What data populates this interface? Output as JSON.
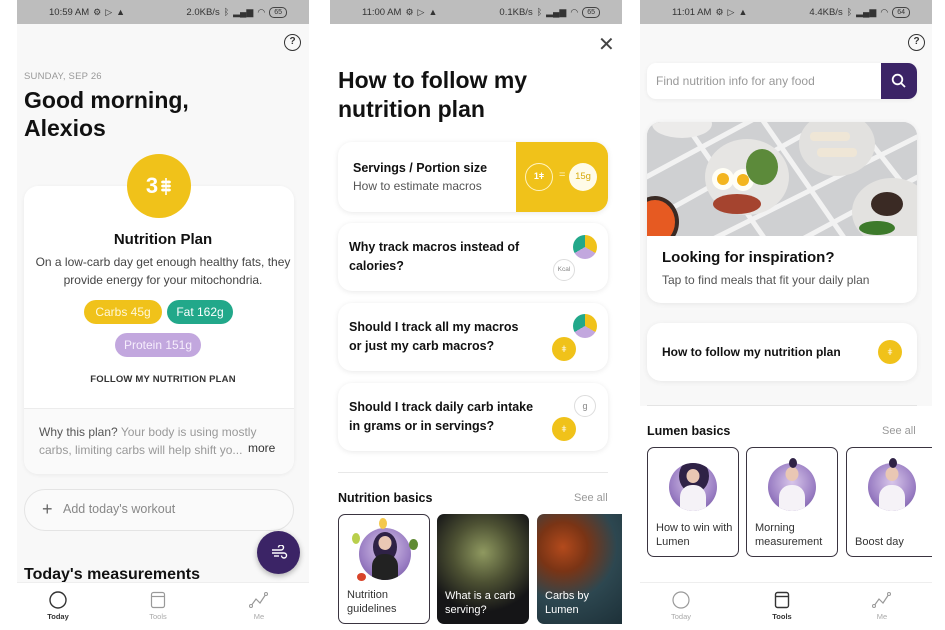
{
  "screens": [
    {
      "status": {
        "time": "10:59 AM",
        "speed": "2.0KB/s",
        "battery": "65"
      },
      "date": "SUNDAY, SEP 26",
      "greeting": "Good morning, Alexios",
      "plan": {
        "badge_number": "3",
        "title": "Nutrition Plan",
        "description": "On a low-carb day get enough healthy fats, they provide energy for your mitochondria.",
        "macros": {
          "carbs": "Carbs 45g",
          "fat": "Fat 162g",
          "protein": "Protein 151g"
        },
        "follow_link": "FOLLOW MY NUTRITION PLAN",
        "why_question": "Why this plan?",
        "why_text": " Your body is using mostly carbs, limiting carbs will help shift yo...",
        "more": "more"
      },
      "workout_label": "Add today's workout",
      "measurements_title": "Today's measurements",
      "tabs": [
        {
          "label": "Today",
          "icon": "circle-icon",
          "active": true
        },
        {
          "label": "Tools",
          "icon": "tools-icon",
          "active": false
        },
        {
          "label": "Me",
          "icon": "chart-line-icon",
          "active": false
        }
      ]
    },
    {
      "status": {
        "time": "11:00 AM",
        "speed": "0.1KB/s",
        "battery": "65"
      },
      "title": "How to follow my nutrition plan",
      "servings_card": {
        "title": "Servings / Portion size",
        "subtitle": "How to estimate macros",
        "serving_count": "1",
        "serving_grams": "15g",
        "equals": "="
      },
      "faqs": [
        {
          "question": "Why track macros instead of calories?",
          "badge_text": "Kcal"
        },
        {
          "question": "Should I track all my macros or just my carb macros?"
        },
        {
          "question": "Should I track daily carb intake in grams or in servings?",
          "badge_text": "g"
        }
      ],
      "section_title": "Nutrition basics",
      "see_all": "See all",
      "tiles": [
        {
          "label": "Nutrition guidelines"
        },
        {
          "label": "What is a carb serving?"
        },
        {
          "label": "Carbs by Lumen"
        }
      ]
    },
    {
      "status": {
        "time": "11:01 AM",
        "speed": "4.4KB/s",
        "battery": "64"
      },
      "search_placeholder": "Find nutrition info for any food",
      "inspiration": {
        "title": "Looking for inspiration?",
        "subtitle": "Tap to find meals that fit your daily plan"
      },
      "how_to_card": "How to follow my nutrition plan",
      "section_title": "Lumen basics",
      "see_all": "See all",
      "tiles": [
        {
          "label": "How to win with Lumen"
        },
        {
          "label": "Morning measurement"
        },
        {
          "label": "Boost day"
        }
      ],
      "tabs": [
        {
          "label": "Today",
          "icon": "circle-icon",
          "active": false
        },
        {
          "label": "Tools",
          "icon": "tools-icon",
          "active": true
        },
        {
          "label": "Me",
          "icon": "chart-line-icon",
          "active": false
        }
      ]
    }
  ],
  "colors": {
    "brand_purple": "#3b2466",
    "carbs_yellow": "#f0c21a",
    "fat_green": "#22a88a",
    "protein_lilac": "#c2a7de"
  }
}
